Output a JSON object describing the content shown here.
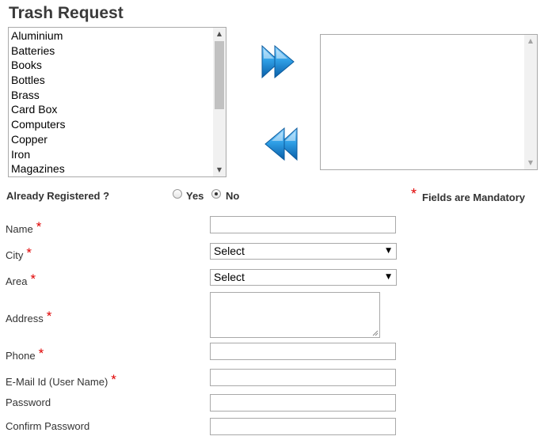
{
  "title": "Trash Request",
  "source_list": {
    "items": [
      "Aluminium",
      "Batteries",
      "Books",
      "Bottles",
      "Brass",
      "Card Box",
      "Computers",
      "Copper",
      "Iron",
      "Magazines"
    ],
    "scroll_up_glyph": "▲",
    "scroll_down_glyph": "▼"
  },
  "target_list": {
    "items": [],
    "scroll_up_glyph": "▲",
    "scroll_down_glyph": "▼"
  },
  "icons": {
    "move_right": "double-arrow-right-icon",
    "move_left": "double-arrow-left-icon"
  },
  "colors": {
    "arrow_blue": "#1e8fd8",
    "mandatory_star": "#e00000"
  },
  "registration": {
    "question": "Already Registered ?",
    "options": [
      {
        "label": "Yes",
        "checked": false
      },
      {
        "label": "No",
        "checked": true
      }
    ],
    "mandatory_note": "Fields are Mandatory",
    "star": "*"
  },
  "form": {
    "name_label": "Name",
    "city_label": "City",
    "city_value": "Select",
    "area_label": "Area",
    "area_value": "Select",
    "address_label": "Address",
    "phone_label": "Phone",
    "email_label": "E-Mail Id (User Name)",
    "password_label": "Password",
    "confirm_password_label": "Confirm Password",
    "star": "*",
    "caret": "▼"
  }
}
